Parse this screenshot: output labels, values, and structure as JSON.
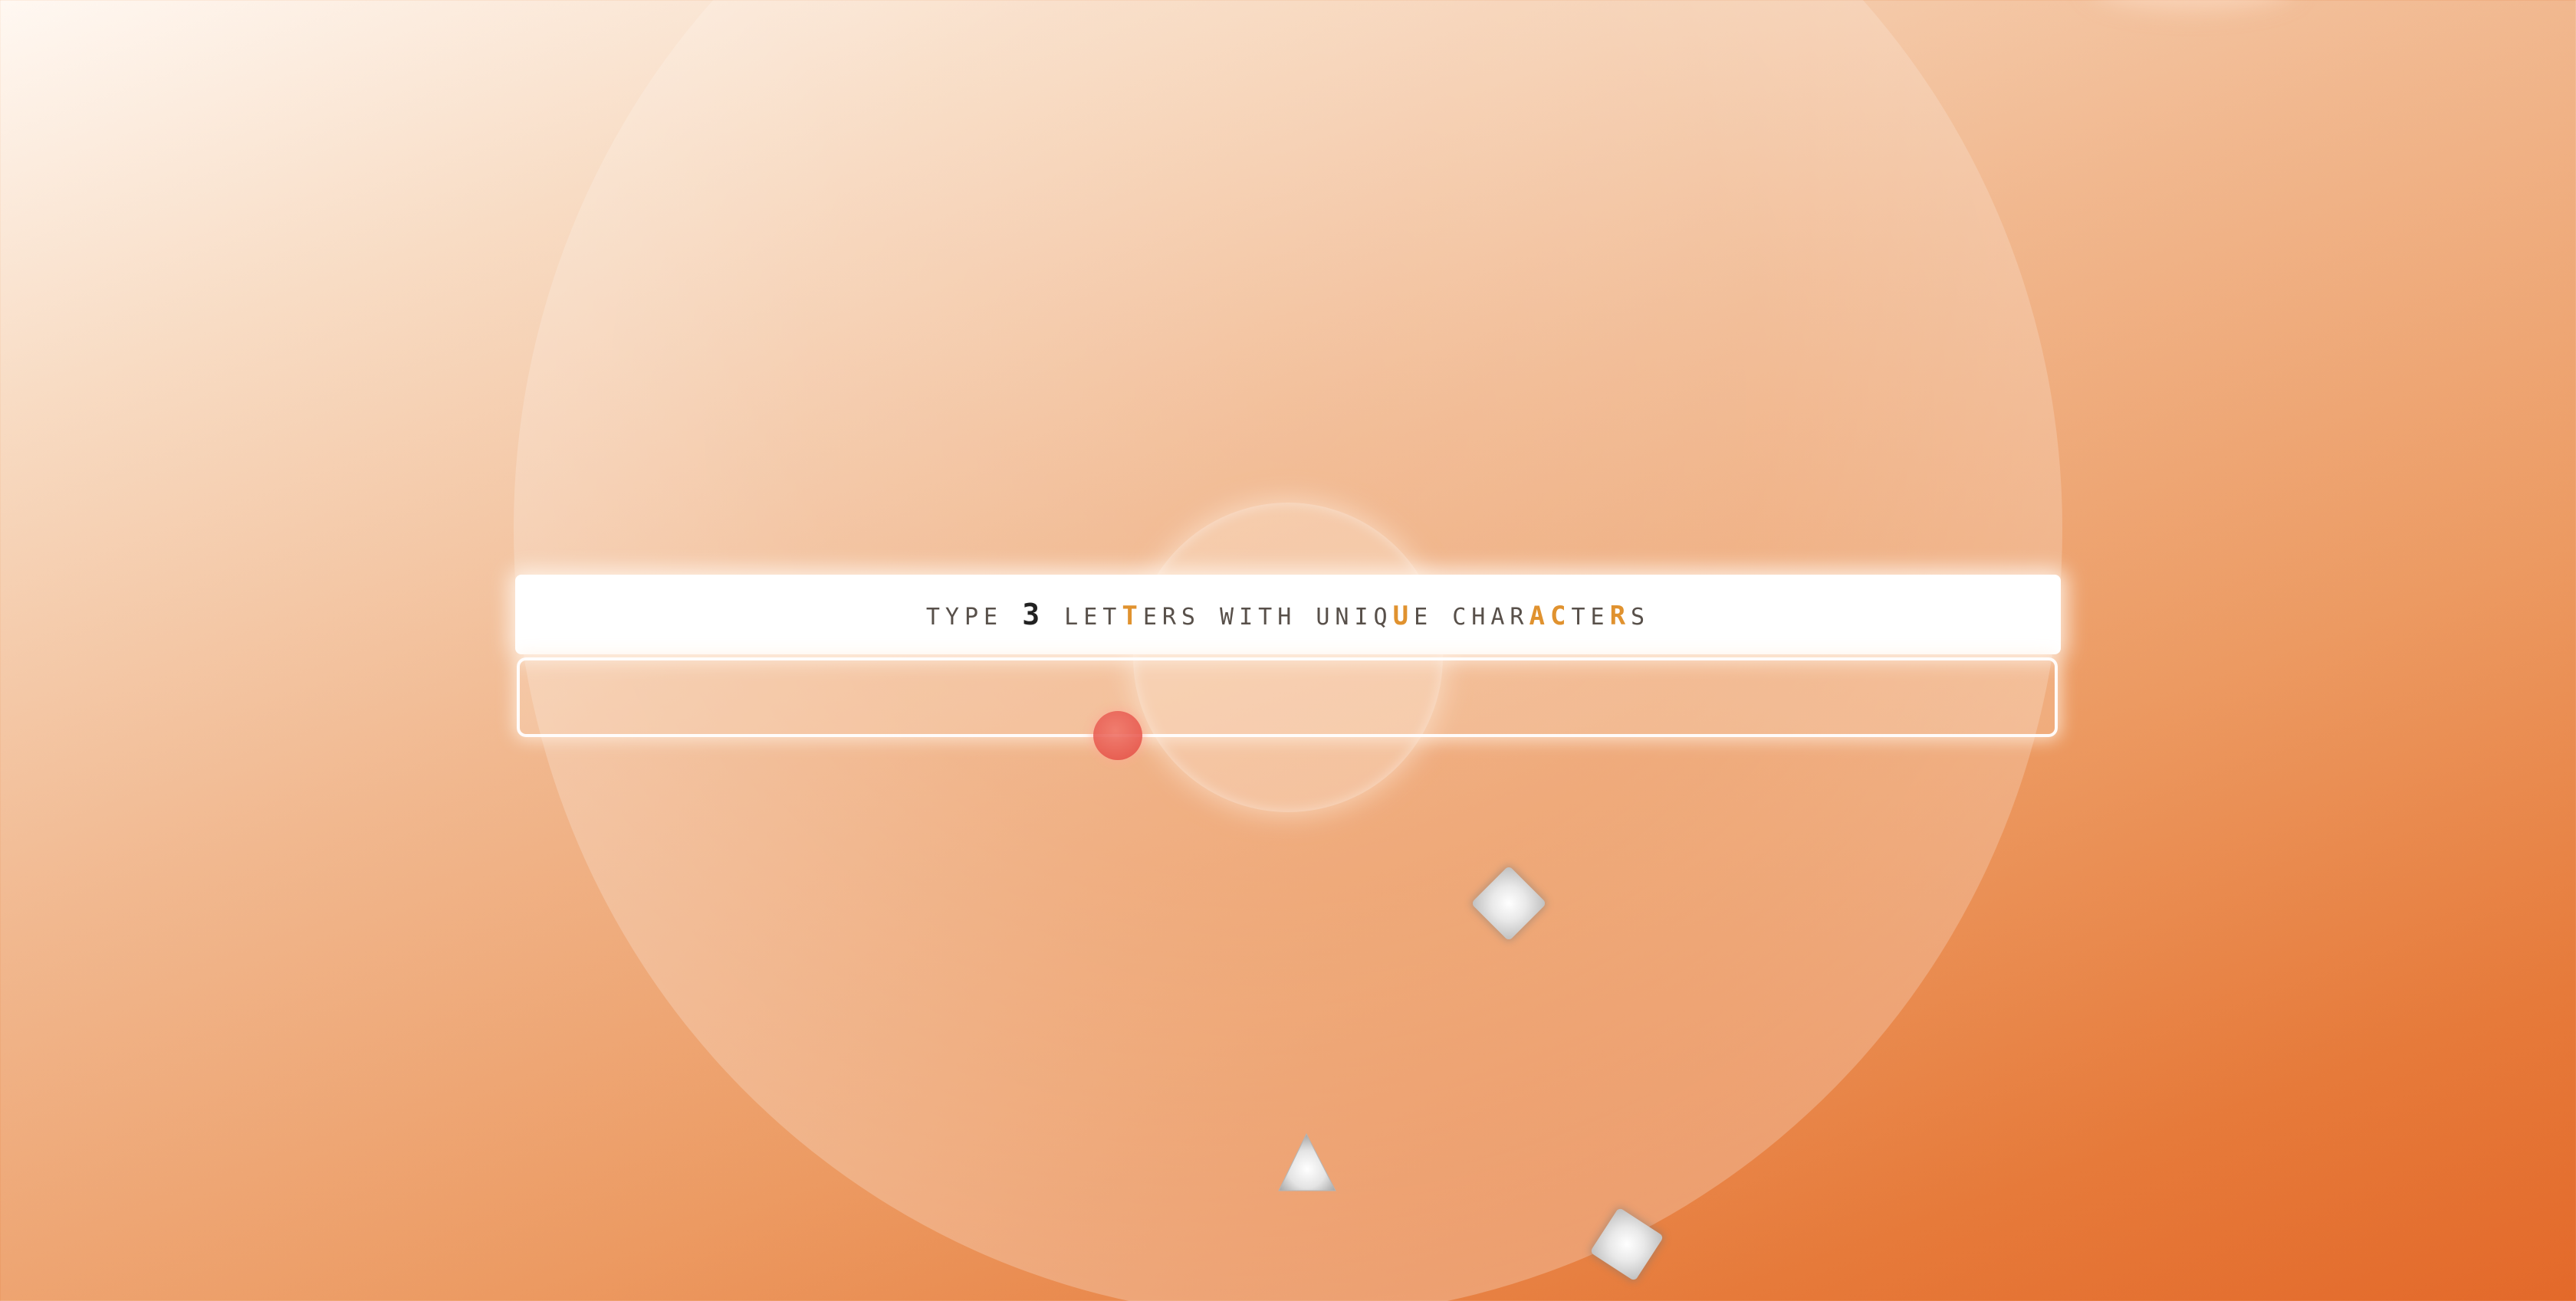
{
  "game": {
    "prompt": {
      "prefix": "TYPE ",
      "number": "3",
      "middle1": " LET",
      "h1": "T",
      "middle2": "ERS WITH UNIQ",
      "h2": "U",
      "middle3": "E CHAR",
      "h3": "AC",
      "middle4": "TE",
      "h4": "R",
      "suffix": "S"
    },
    "answer": {
      "value": "",
      "placeholder": ""
    },
    "colors": {
      "highlight": "#e0922f",
      "ball": "#e8594f",
      "background_start": "#fff8f2",
      "background_end": "#e3692a"
    },
    "objects": [
      {
        "kind": "ball",
        "name": "red-ball"
      },
      {
        "kind": "diamond",
        "name": "silver-diamond"
      },
      {
        "kind": "triangle",
        "name": "silver-triangle"
      },
      {
        "kind": "diamond",
        "name": "silver-diamond"
      }
    ]
  }
}
